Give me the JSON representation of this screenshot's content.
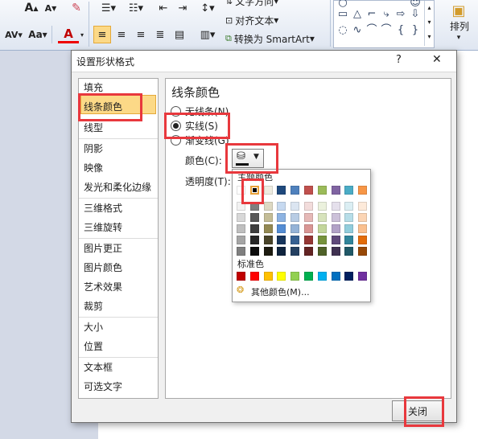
{
  "ribbon": {
    "font_grow": "A",
    "font_shrink": "A",
    "char_spacing": "AV",
    "change_case": "Aa",
    "font_color": "A",
    "text_direction": "文字方向",
    "align_text": "对齐文本",
    "convert_smartart": "转换为 SmartArt",
    "arrange": "排列",
    "shapes": [
      "□",
      "△",
      "⌐",
      "⤿",
      "⇨",
      "☺",
      "○",
      "⌒",
      "∿",
      "⌒",
      "{",
      "}",
      "☆"
    ]
  },
  "dialog": {
    "title": "设置形状格式",
    "help": "?",
    "close_x": "✕",
    "nav_items": [
      "填充",
      "线条颜色",
      "线型",
      "阴影",
      "映像",
      "发光和柔化边缘",
      "三维格式",
      "三维旋转",
      "图片更正",
      "图片颜色",
      "艺术效果",
      "裁剪",
      "大小",
      "位置",
      "文本框",
      "可选文字"
    ],
    "selected_nav": "线条颜色",
    "section_title": "线条颜色",
    "options": [
      {
        "label": "无线条(N)",
        "checked": false
      },
      {
        "label": "实线(S)",
        "checked": true
      },
      {
        "label": "渐变线(G)",
        "checked": false
      }
    ],
    "color_label": "颜色(C):",
    "transparency_label": "透明度(T):",
    "close_button": "关闭"
  },
  "color_picker": {
    "theme_label": "主题颜色",
    "theme_top": [
      "#ffffff",
      "#000000",
      "#eeece1",
      "#1f497d",
      "#4f81bd",
      "#c0504d",
      "#9bbb59",
      "#8064a2",
      "#4bacc6",
      "#f79646"
    ],
    "theme_shades": [
      [
        "#f2f2f2",
        "#d8d8d8",
        "#bfbfbf",
        "#a5a5a5",
        "#7f7f7f"
      ],
      [
        "#7f7f7f",
        "#595959",
        "#3f3f3f",
        "#262626",
        "#0c0c0c"
      ],
      [
        "#ddd9c3",
        "#c4bd97",
        "#938953",
        "#494429",
        "#1d1b10"
      ],
      [
        "#c6d9f0",
        "#8db3e2",
        "#548dd4",
        "#17365d",
        "#0f243e"
      ],
      [
        "#dbe5f1",
        "#b8cce4",
        "#95b3d7",
        "#366092",
        "#244061"
      ],
      [
        "#f2dcdb",
        "#e5b9b7",
        "#d99694",
        "#953734",
        "#632423"
      ],
      [
        "#ebf1dd",
        "#d7e3bc",
        "#c3d69b",
        "#76923c",
        "#4f6128"
      ],
      [
        "#e5e0ec",
        "#ccc1d9",
        "#b2a2c7",
        "#5f497a",
        "#3f3151"
      ],
      [
        "#dbeef3",
        "#b7dde8",
        "#92cddc",
        "#31859b",
        "#205867"
      ],
      [
        "#fdeada",
        "#fbd5b5",
        "#fac08f",
        "#e36c09",
        "#974806"
      ]
    ],
    "standard_label": "标准色",
    "standard": [
      "#c00000",
      "#ff0000",
      "#ffc000",
      "#ffff00",
      "#92d050",
      "#00b050",
      "#00b0f0",
      "#0070c0",
      "#002060",
      "#7030a0"
    ],
    "more_colors": "其他颜色(M)..."
  },
  "colors": {
    "highlight": "#fcd987",
    "annotation": "#e8383d"
  }
}
